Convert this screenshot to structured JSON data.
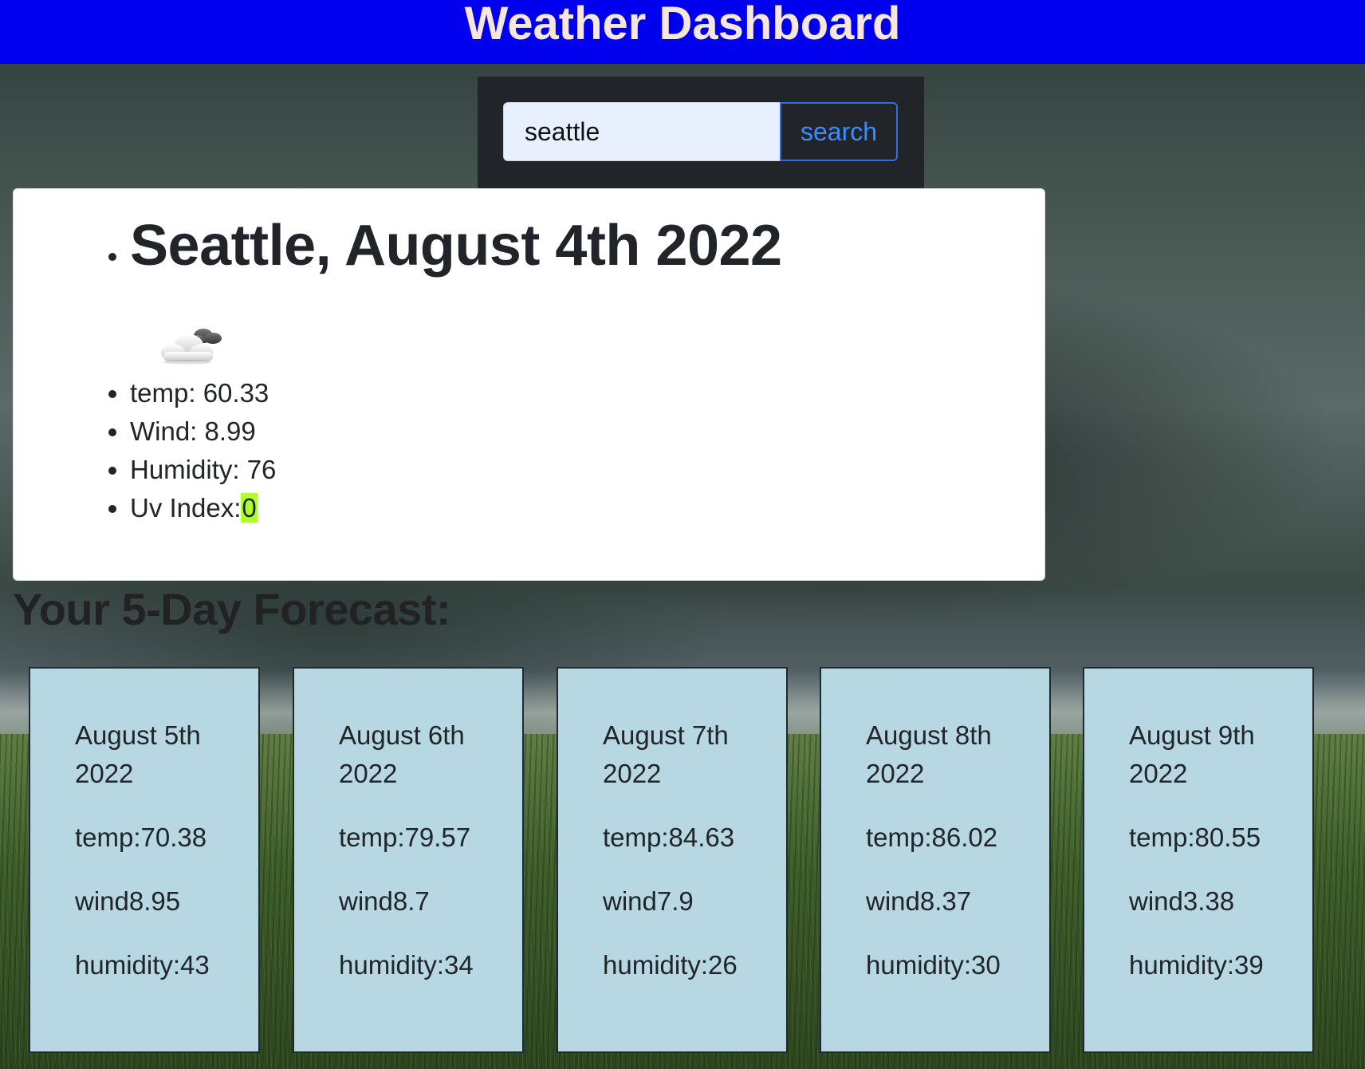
{
  "header": {
    "title": "Weather Dashboard"
  },
  "search": {
    "value": "seattle",
    "button_label": "search"
  },
  "current": {
    "title": "Seattle, August 4th 2022",
    "icon": "partly-cloudy-icon",
    "temp": "temp: 60.33",
    "wind": "Wind: 8.99",
    "humidity": "Humidity: 76",
    "uv_label": "Uv Index:",
    "uv_value": "0",
    "uv_color": "#adff2f"
  },
  "forecast": {
    "heading": "Your 5-Day Forecast:",
    "days": [
      {
        "date": "August 5th 2022",
        "temp": "temp:70.38",
        "wind": "wind8.95",
        "humidity": "humidity:43"
      },
      {
        "date": "August 6th 2022",
        "temp": "temp:79.57",
        "wind": "wind8.7",
        "humidity": "humidity:34"
      },
      {
        "date": "August 7th 2022",
        "temp": "temp:84.63",
        "wind": "wind7.9",
        "humidity": "humidity:26"
      },
      {
        "date": "August 8th 2022",
        "temp": "temp:86.02",
        "wind": "wind8.37",
        "humidity": "humidity:30"
      },
      {
        "date": "August 9th 2022",
        "temp": "temp:80.55",
        "wind": "wind3.38",
        "humidity": "humidity:39"
      }
    ]
  },
  "colors": {
    "header_bg": "#0000ee",
    "header_text": "#f7e6dd",
    "card_bg": "#b7d8e3",
    "search_button_text": "#3d8bfd"
  }
}
